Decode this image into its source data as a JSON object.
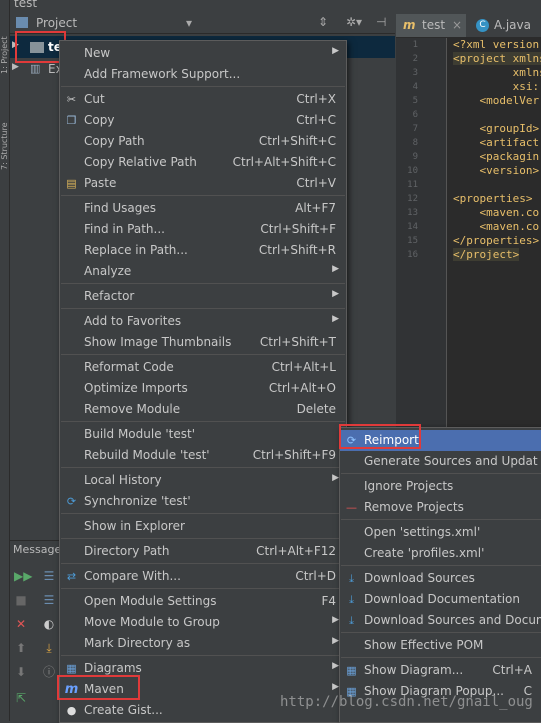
{
  "window_title": "test",
  "project_panel": {
    "title": "Project",
    "tree": [
      {
        "label": "te",
        "selected": true
      },
      {
        "label": "Ex",
        "selected": false
      }
    ]
  },
  "editor": {
    "tabs": [
      {
        "label": "test",
        "icon": "maven-m-icon"
      },
      {
        "label": "A.java",
        "icon": "java-class-icon"
      }
    ],
    "line_numbers": [
      "1",
      "2",
      "3",
      "4",
      "5",
      "6",
      "7",
      "8",
      "9",
      "10",
      "11",
      "12",
      "13",
      "14",
      "15",
      "16"
    ],
    "code_lines": [
      "<?xml version",
      "<project xmlns",
      "         xmlns",
      "         xsi:",
      "    <modelVer",
      "",
      "    <groupId>",
      "    <artifact",
      "    <packagin",
      "    <version>",
      "",
      "<properties>",
      "    <maven.co",
      "    <maven.co",
      "</properties>",
      "</project>"
    ]
  },
  "messages_panel": {
    "title": "Messages"
  },
  "context_menu": {
    "items": [
      {
        "label": "New",
        "shortcut": "",
        "submenu": true,
        "icon": ""
      },
      {
        "label": "Add Framework Support...",
        "shortcut": "",
        "submenu": false,
        "icon": ""
      },
      {
        "sep": true
      },
      {
        "label": "Cut",
        "shortcut": "Ctrl+X",
        "submenu": false,
        "icon": "scissors-icon"
      },
      {
        "label": "Copy",
        "shortcut": "Ctrl+C",
        "submenu": false,
        "icon": "copy-icon"
      },
      {
        "label": "Copy Path",
        "shortcut": "Ctrl+Shift+C",
        "submenu": false,
        "icon": ""
      },
      {
        "label": "Copy Relative Path",
        "shortcut": "Ctrl+Alt+Shift+C",
        "submenu": false,
        "icon": ""
      },
      {
        "label": "Paste",
        "shortcut": "Ctrl+V",
        "submenu": false,
        "icon": "paste-icon"
      },
      {
        "sep": true
      },
      {
        "label": "Find Usages",
        "shortcut": "Alt+F7",
        "submenu": false,
        "icon": ""
      },
      {
        "label": "Find in Path...",
        "shortcut": "Ctrl+Shift+F",
        "submenu": false,
        "icon": ""
      },
      {
        "label": "Replace in Path...",
        "shortcut": "Ctrl+Shift+R",
        "submenu": false,
        "icon": ""
      },
      {
        "label": "Analyze",
        "shortcut": "",
        "submenu": true,
        "icon": ""
      },
      {
        "sep": true
      },
      {
        "label": "Refactor",
        "shortcut": "",
        "submenu": true,
        "icon": ""
      },
      {
        "sep": true
      },
      {
        "label": "Add to Favorites",
        "shortcut": "",
        "submenu": true,
        "icon": ""
      },
      {
        "label": "Show Image Thumbnails",
        "shortcut": "Ctrl+Shift+T",
        "submenu": false,
        "icon": ""
      },
      {
        "sep": true
      },
      {
        "label": "Reformat Code",
        "shortcut": "Ctrl+Alt+L",
        "submenu": false,
        "icon": ""
      },
      {
        "label": "Optimize Imports",
        "shortcut": "Ctrl+Alt+O",
        "submenu": false,
        "icon": ""
      },
      {
        "label": "Remove Module",
        "shortcut": "Delete",
        "submenu": false,
        "icon": ""
      },
      {
        "sep": true
      },
      {
        "label": "Build Module 'test'",
        "shortcut": "",
        "submenu": false,
        "icon": ""
      },
      {
        "label": "Rebuild Module 'test'",
        "shortcut": "Ctrl+Shift+F9",
        "submenu": false,
        "icon": ""
      },
      {
        "sep": true
      },
      {
        "label": "Local History",
        "shortcut": "",
        "submenu": true,
        "icon": ""
      },
      {
        "label": "Synchronize 'test'",
        "shortcut": "",
        "submenu": false,
        "icon": "sync-icon"
      },
      {
        "sep": true
      },
      {
        "label": "Show in Explorer",
        "shortcut": "",
        "submenu": false,
        "icon": ""
      },
      {
        "sep": true
      },
      {
        "label": "Directory Path",
        "shortcut": "Ctrl+Alt+F12",
        "submenu": false,
        "icon": ""
      },
      {
        "sep": true
      },
      {
        "label": "Compare With...",
        "shortcut": "Ctrl+D",
        "submenu": false,
        "icon": "compare-icon"
      },
      {
        "sep": true
      },
      {
        "label": "Open Module Settings",
        "shortcut": "F4",
        "submenu": false,
        "icon": ""
      },
      {
        "label": "Move Module to Group",
        "shortcut": "",
        "submenu": true,
        "icon": ""
      },
      {
        "label": "Mark Directory as",
        "shortcut": "",
        "submenu": true,
        "icon": ""
      },
      {
        "sep": true
      },
      {
        "label": "Diagrams",
        "shortcut": "",
        "submenu": true,
        "icon": "diagram-icon"
      },
      {
        "label": "Maven",
        "shortcut": "",
        "submenu": true,
        "icon": "maven-m-icon"
      },
      {
        "label": "Create Gist...",
        "shortcut": "",
        "submenu": false,
        "icon": "github-icon"
      }
    ]
  },
  "maven_submenu": {
    "items": [
      {
        "label": "Reimport",
        "shortcut": "",
        "icon": "reimport-icon",
        "highlighted": true
      },
      {
        "label": "Generate Sources and Updat",
        "shortcut": "",
        "icon": "",
        "highlighted": false
      },
      {
        "sep": true
      },
      {
        "label": "Ignore Projects",
        "shortcut": "",
        "icon": "",
        "highlighted": false
      },
      {
        "label": "Remove Projects",
        "shortcut": "",
        "icon": "minus-icon",
        "highlighted": false
      },
      {
        "sep": true
      },
      {
        "label": "Open 'settings.xml'",
        "shortcut": "",
        "icon": "",
        "highlighted": false
      },
      {
        "label": "Create 'profiles.xml'",
        "shortcut": "",
        "icon": "",
        "highlighted": false
      },
      {
        "sep": true
      },
      {
        "label": "Download Sources",
        "shortcut": "",
        "icon": "download-icon",
        "highlighted": false
      },
      {
        "label": "Download Documentation",
        "shortcut": "",
        "icon": "download-icon",
        "highlighted": false
      },
      {
        "label": "Download Sources and Docum",
        "shortcut": "",
        "icon": "download-icon",
        "highlighted": false
      },
      {
        "sep": true
      },
      {
        "label": "Show Effective POM",
        "shortcut": "",
        "icon": "",
        "highlighted": false
      },
      {
        "sep": true
      },
      {
        "label": "Show Diagram...",
        "shortcut": "Ctrl+A",
        "icon": "diagram-icon",
        "highlighted": false
      },
      {
        "label": "Show Diagram Popup...",
        "shortcut": "C",
        "icon": "diagram-icon",
        "highlighted": false
      }
    ]
  },
  "watermark": "http://blog.csdn.net/gnail_oug",
  "colors": {
    "background": "#3c3f41",
    "editor_bg": "#2b2b2b",
    "selection": "#4b6eaf",
    "annotation_red": "#e03a3a",
    "xml_tag": "#e8bf6a"
  }
}
